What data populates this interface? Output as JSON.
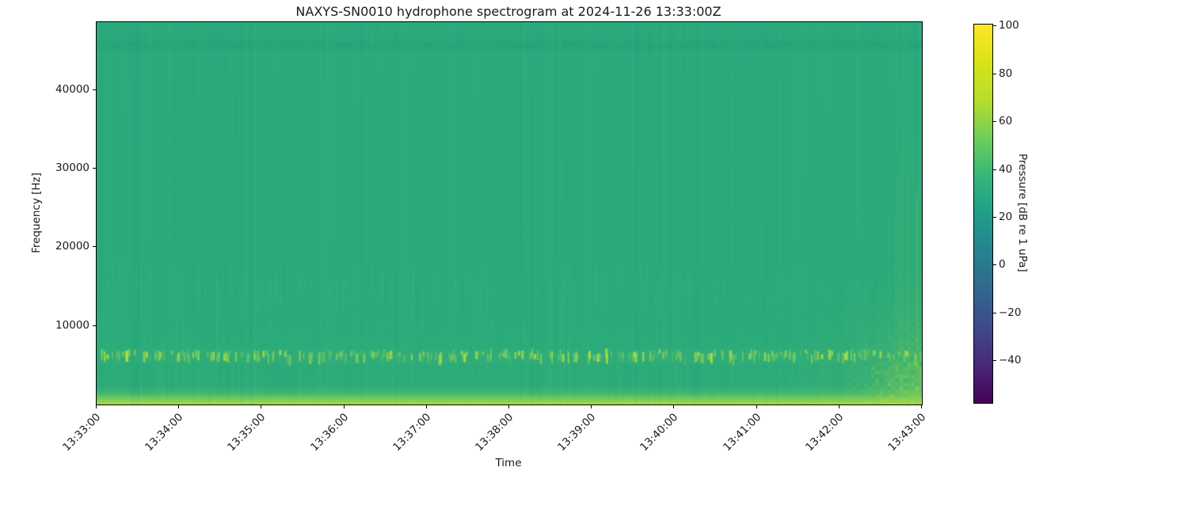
{
  "figure": {
    "kind": "matplotlib-spectrogram-figure",
    "background_color": "#ffffff",
    "spine_color": "#000000",
    "text_color": "#1a1a1a"
  },
  "chart_data": {
    "type": "heatmap",
    "subtype": "spectrogram",
    "title": "NAXYS-SN0010 hydrophone spectrogram at 2024-11-26 13:33:00Z",
    "xlabel": "Time",
    "ylabel": "Frequency [Hz]",
    "x_tick_labels": [
      "13:33:00",
      "13:34:00",
      "13:35:00",
      "13:36:00",
      "13:37:00",
      "13:38:00",
      "13:39:00",
      "13:40:00",
      "13:41:00",
      "13:42:00",
      "13:43:00"
    ],
    "x_range": [
      "13:33:00",
      "13:43:00"
    ],
    "y_tick_values": [
      10000,
      20000,
      30000,
      40000
    ],
    "y_tick_labels": [
      "10000",
      "20000",
      "30000",
      "40000"
    ],
    "y_range_hz": [
      0,
      48640
    ],
    "grid": false,
    "colorbar": {
      "label": "Pressure [dB re 1 uPa]",
      "tick_values": [
        100,
        80,
        60,
        40,
        20,
        0,
        -20,
        -40
      ],
      "tick_labels": [
        "100",
        "80",
        "60",
        "40",
        "20",
        "0",
        "−20",
        "−40"
      ],
      "value_range": [
        -57.4,
        100.7
      ],
      "colormap": "viridis",
      "stops": [
        [
          0.0,
          "#440154"
        ],
        [
          0.1,
          "#482878"
        ],
        [
          0.2,
          "#3e4a89"
        ],
        [
          0.3,
          "#31688e"
        ],
        [
          0.4,
          "#26828e"
        ],
        [
          0.5,
          "#1f9e89"
        ],
        [
          0.6,
          "#35b779"
        ],
        [
          0.7,
          "#6ece58"
        ],
        [
          0.8,
          "#b5de2b"
        ],
        [
          0.9,
          "#d8e219"
        ],
        [
          1.0,
          "#fde725"
        ]
      ]
    },
    "content_summary": {
      "background_level_db": "~40-50 dB broadband (uniform green)",
      "features": [
        "quasi-periodic transient clicks in a narrow band near 5-7 kHz (bright yellow-green dashes) across the whole record",
        "faint vertical transient streaks between ~10-16 kHz",
        "persistent bright band below ~1.5 kHz at ~70-85 dB along the bottom edge",
        "broadband level increase near 13:42:30-13:43:00, strongest below ~12 kHz (yellow-green patch with interference crosshatch)",
        "subtle slightly-darker horizontal band near ~45 kHz"
      ]
    },
    "render": {
      "seed": 42,
      "base_gradient": [
        [
          0.0,
          "#2cac7d"
        ],
        [
          0.05,
          "#29a87b"
        ],
        [
          0.08,
          "#2bab7d"
        ],
        [
          0.75,
          "#2baa7c"
        ],
        [
          0.952,
          "#2ead7a"
        ],
        [
          0.972,
          "#47ba70"
        ],
        [
          0.988,
          "#82ce58"
        ],
        [
          1.0,
          "#a9dc49"
        ]
      ],
      "faint_streaks": {
        "count": 350,
        "color": "#63cb8a",
        "dark_color": "#1f9e78",
        "dark_count": 160
      },
      "mid_band": {
        "y": [
          0.617,
          0.762
        ],
        "count": 260,
        "color": "#4fc47c",
        "accent_color": "#8ad65f",
        "accent_count": 70
      },
      "tall_streaks": {
        "count": 26,
        "color": "#5ecb81"
      },
      "dash_band": {
        "y": [
          0.852,
          0.896
        ],
        "bg_color": "#47bd72",
        "count": 300,
        "colors": [
          "#7ccf5e",
          "#92d553",
          "#b4e03f",
          "#5ec66a"
        ]
      },
      "smudge_band": {
        "y": [
          0.892,
          0.973
        ],
        "count": 130,
        "light": "#3cb57a",
        "dark": "#249f76"
      },
      "blob": {
        "x0": 0.795,
        "y0": 0.58,
        "color": "#9bd84e",
        "hot_color": "#c9e63a"
      },
      "edge_streaks": {
        "count": 22,
        "color": "#84d15c"
      },
      "dark_band": {
        "y": [
          0.052,
          0.074
        ],
        "color": "#0f7a6e"
      }
    }
  }
}
